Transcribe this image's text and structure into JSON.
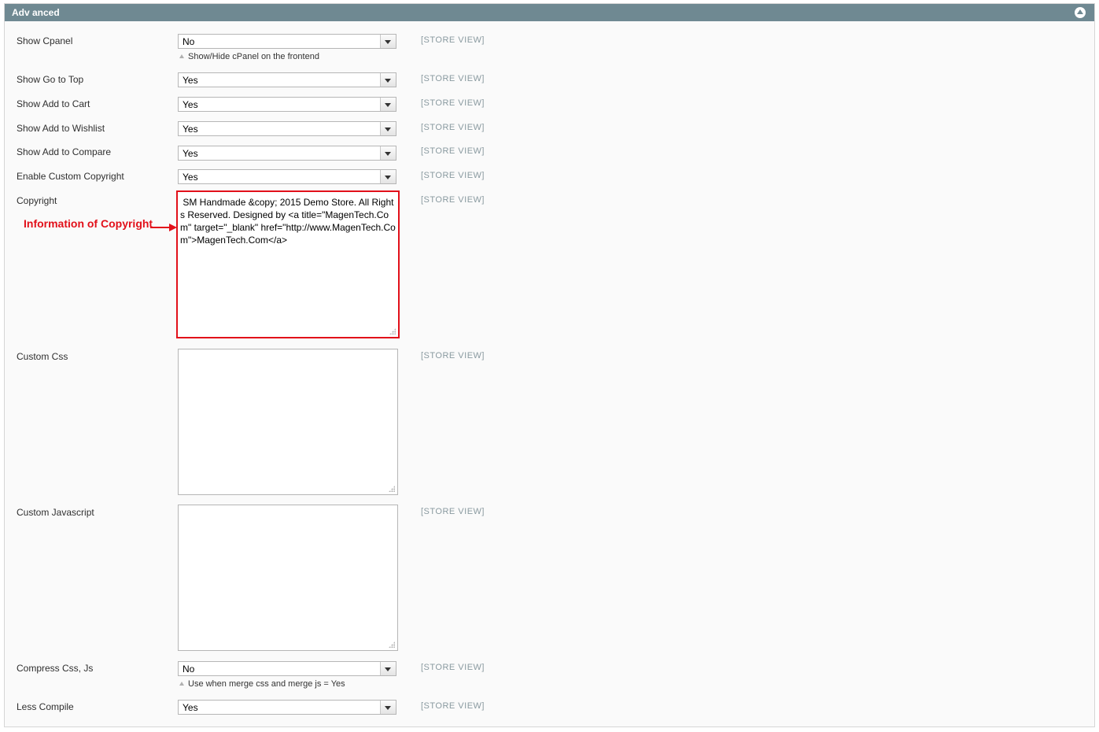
{
  "section": {
    "title": "Adv anced"
  },
  "scope_label": "[STORE VIEW]",
  "fields": {
    "show_cpanel": {
      "label": "Show Cpanel",
      "value": "No",
      "note": "Show/Hide cPanel on the frontend"
    },
    "show_go_to_top": {
      "label": "Show Go to Top",
      "value": "Yes"
    },
    "show_add_to_cart": {
      "label": "Show Add to Cart",
      "value": "Yes"
    },
    "show_add_to_wishlist": {
      "label": "Show Add to Wishlist",
      "value": "Yes"
    },
    "show_add_to_compare": {
      "label": "Show Add to Compare",
      "value": "Yes"
    },
    "enable_custom_copyright": {
      "label": "Enable Custom Copyright",
      "value": "Yes"
    },
    "copyright": {
      "label": "Copyright",
      "value": " SM Handmade &copy; 2015 Demo Store. All Rights Reserved. Designed by <a title=\"MagenTech.Com\" target=\"_blank\" href=\"http://www.MagenTech.Com\">MagenTech.Com</a>"
    },
    "custom_css": {
      "label": "Custom Css",
      "value": ""
    },
    "custom_javascript": {
      "label": "Custom Javascript",
      "value": ""
    },
    "compress_css_js": {
      "label": "Compress Css, Js",
      "value": "No",
      "note": "Use when merge css and merge js = Yes"
    },
    "less_compile": {
      "label": "Less Compile",
      "value": "Yes"
    }
  },
  "annotation": {
    "text": "Information of Copyright",
    "color": "#e2101a"
  }
}
